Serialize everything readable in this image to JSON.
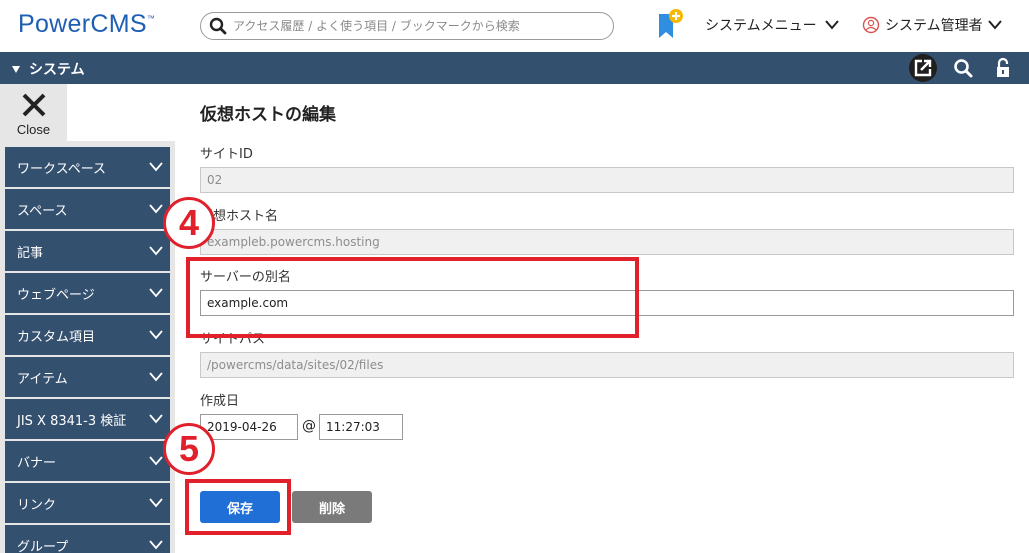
{
  "header": {
    "logo": "PowerCMS",
    "logo_tm": "™",
    "search_placeholder": "アクセス履歴 / よく使う項目 / ブックマークから検索",
    "system_menu": "システムメニュー",
    "admin_user": "システム管理者"
  },
  "navbar": {
    "title": "システム",
    "icons": [
      "external-link-icon",
      "search-icon",
      "unlock-icon"
    ]
  },
  "sidebar": {
    "close_label": "Close",
    "items": [
      {
        "label": "ワークスペース"
      },
      {
        "label": "スペース"
      },
      {
        "label": "記事"
      },
      {
        "label": "ウェブページ"
      },
      {
        "label": "カスタム項目"
      },
      {
        "label": "アイテム"
      },
      {
        "label": "JIS X 8341-3 検証"
      },
      {
        "label": "バナー"
      },
      {
        "label": "リンク"
      },
      {
        "label": "グループ"
      }
    ]
  },
  "form": {
    "title": "仮想ホストの編集",
    "site_id": {
      "label": "サイトID",
      "value": "02"
    },
    "vhost_name": {
      "label": "仮想ホスト名",
      "value": "exampleb.powercms.hosting"
    },
    "server_alias": {
      "label": "サーバーの別名",
      "value": "example.com"
    },
    "site_path": {
      "label": "サイトパス",
      "value": "/powercms/data/sites/02/files"
    },
    "created": {
      "label": "作成日",
      "date": "2019-04-26",
      "separator": "@",
      "time": "11:27:03"
    },
    "save_label": "保存",
    "delete_label": "削除"
  },
  "annotations": {
    "step4": "4",
    "step5": "5",
    "color": "#e0202b"
  },
  "colors": {
    "brand_blue": "#1f5fb3",
    "nav_bg": "#34506f",
    "save_btn": "#1f6fd6",
    "delete_btn": "#7a7a7a"
  }
}
